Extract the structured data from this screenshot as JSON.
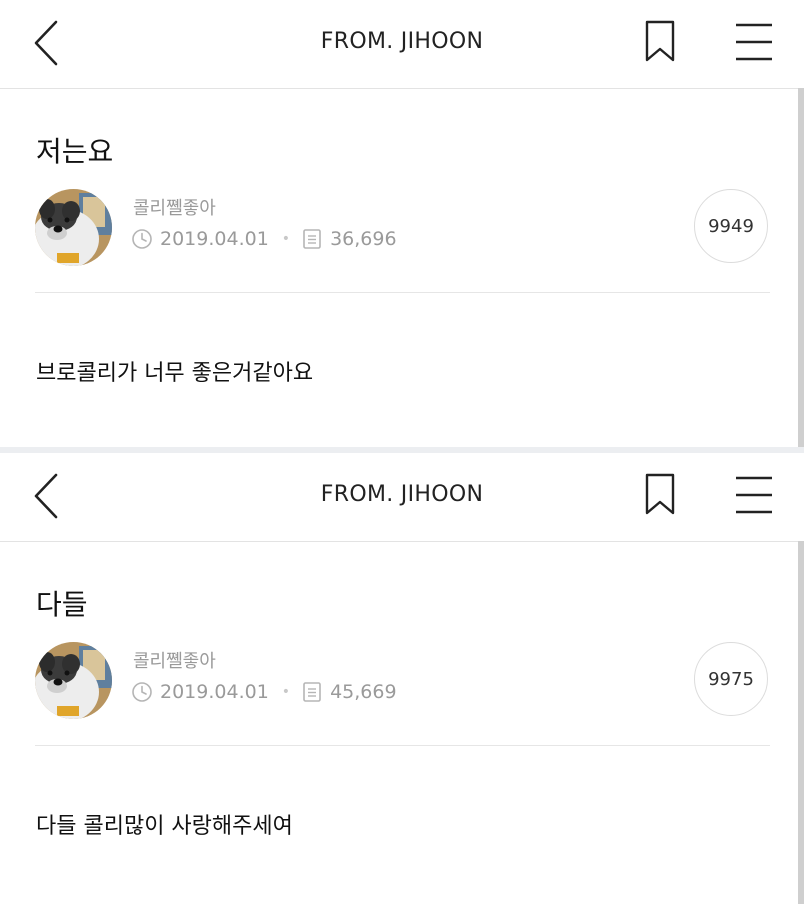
{
  "posts": [
    {
      "header_title": "FROM. JIHOON",
      "title": "저는요",
      "author": "콜리쪨좋아",
      "date": "2019.04.01",
      "views": "36,696",
      "count": "9949",
      "body": "브로콜리가 너무 좋은거같아요"
    },
    {
      "header_title": "FROM. JIHOON",
      "title": "다들",
      "author": "콜리쪨좋아",
      "date": "2019.04.01",
      "views": "45,669",
      "count": "9975",
      "body": "다들 콜리많이 사랑해주세여"
    }
  ],
  "icons": {
    "back": "chevron-left-icon",
    "bookmark": "bookmark-icon",
    "menu": "hamburger-menu-icon",
    "date": "clock-icon",
    "views": "document-icon"
  },
  "colors": {
    "meta_text": "#9a9a9a",
    "divider": "#e6e6e6",
    "separator": "#eceef1"
  }
}
